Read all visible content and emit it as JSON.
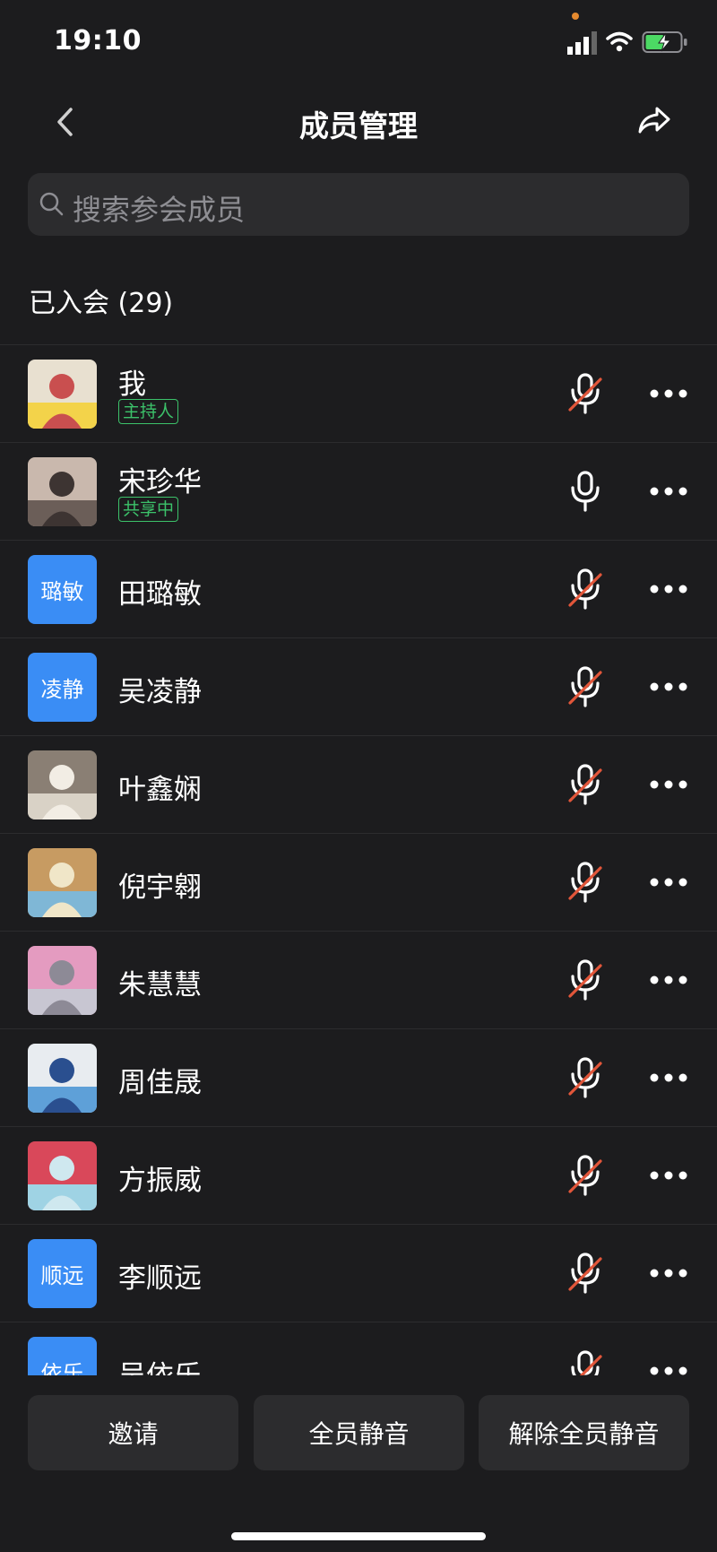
{
  "status": {
    "time": "19:10"
  },
  "header": {
    "title": "成员管理"
  },
  "search": {
    "placeholder": "搜索参会成员"
  },
  "section": {
    "label": "已入会 (29)"
  },
  "members": [
    {
      "name": "我",
      "tag": "主持人",
      "avatar_type": "photo",
      "avatar_desc": "photo-woman-sunflowers",
      "mic": "muted"
    },
    {
      "name": "宋珍华",
      "tag": "共享中",
      "avatar_type": "photo",
      "avatar_desc": "photo-selfie",
      "mic": "on"
    },
    {
      "name": "田璐敏",
      "avatar_type": "text",
      "avatar_text": "璐敏",
      "mic": "muted"
    },
    {
      "name": "吴凌静",
      "avatar_type": "text",
      "avatar_text": "凌静",
      "mic": "muted"
    },
    {
      "name": "叶鑫娴",
      "avatar_type": "photo",
      "avatar_desc": "photo-girl",
      "mic": "muted"
    },
    {
      "name": "倪宇翱",
      "avatar_type": "photo",
      "avatar_desc": "photo-car-beach",
      "mic": "muted"
    },
    {
      "name": "朱慧慧",
      "avatar_type": "photo",
      "avatar_desc": "photo-child-scooter",
      "mic": "muted"
    },
    {
      "name": "周佳晟",
      "avatar_type": "photo",
      "avatar_desc": "photo-man-blue-hat",
      "mic": "muted"
    },
    {
      "name": "方振威",
      "avatar_type": "photo",
      "avatar_desc": "photo-scooter-sea",
      "mic": "muted"
    },
    {
      "name": "李顺远",
      "avatar_type": "text",
      "avatar_text": "顺远",
      "mic": "muted"
    },
    {
      "name": "吴依乐",
      "avatar_type": "text",
      "avatar_text": "依乐",
      "mic": "muted"
    }
  ],
  "actions": {
    "invite": "邀请",
    "mute_all": "全员静音",
    "unmute_all": "解除全员静音"
  },
  "colors": {
    "accent": "#3a8df5",
    "tag": "#3cc26a",
    "mute_slash": "#e2563a",
    "background": "#1c1c1e"
  }
}
